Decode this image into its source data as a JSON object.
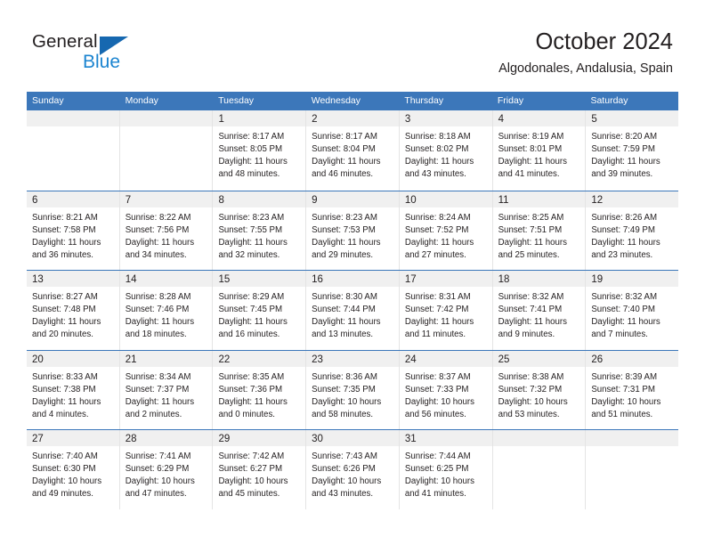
{
  "brand": {
    "name_part1": "General",
    "name_part2": "Blue",
    "triangle_icon": "blue-triangle-icon",
    "blue": "#1668b0",
    "light_blue": "#1b84d0"
  },
  "header": {
    "title": "October 2024",
    "subtitle": "Algodonales, Andalusia, Spain"
  },
  "colors": {
    "header_blue": "#3c77ba",
    "date_band_gray": "#f0f0f0",
    "column_divider": "#e4e4e4",
    "text": "#231f20"
  },
  "calendar": {
    "weekday_headers": [
      "Sunday",
      "Monday",
      "Tuesday",
      "Wednesday",
      "Thursday",
      "Friday",
      "Saturday"
    ],
    "weeks": [
      [
        {
          "date": "",
          "lines": []
        },
        {
          "date": "",
          "lines": []
        },
        {
          "date": "1",
          "lines": [
            "Sunrise: 8:17 AM",
            "Sunset: 8:05 PM",
            "Daylight: 11 hours",
            "and 48 minutes."
          ]
        },
        {
          "date": "2",
          "lines": [
            "Sunrise: 8:17 AM",
            "Sunset: 8:04 PM",
            "Daylight: 11 hours",
            "and 46 minutes."
          ]
        },
        {
          "date": "3",
          "lines": [
            "Sunrise: 8:18 AM",
            "Sunset: 8:02 PM",
            "Daylight: 11 hours",
            "and 43 minutes."
          ]
        },
        {
          "date": "4",
          "lines": [
            "Sunrise: 8:19 AM",
            "Sunset: 8:01 PM",
            "Daylight: 11 hours",
            "and 41 minutes."
          ]
        },
        {
          "date": "5",
          "lines": [
            "Sunrise: 8:20 AM",
            "Sunset: 7:59 PM",
            "Daylight: 11 hours",
            "and 39 minutes."
          ]
        }
      ],
      [
        {
          "date": "6",
          "lines": [
            "Sunrise: 8:21 AM",
            "Sunset: 7:58 PM",
            "Daylight: 11 hours",
            "and 36 minutes."
          ]
        },
        {
          "date": "7",
          "lines": [
            "Sunrise: 8:22 AM",
            "Sunset: 7:56 PM",
            "Daylight: 11 hours",
            "and 34 minutes."
          ]
        },
        {
          "date": "8",
          "lines": [
            "Sunrise: 8:23 AM",
            "Sunset: 7:55 PM",
            "Daylight: 11 hours",
            "and 32 minutes."
          ]
        },
        {
          "date": "9",
          "lines": [
            "Sunrise: 8:23 AM",
            "Sunset: 7:53 PM",
            "Daylight: 11 hours",
            "and 29 minutes."
          ]
        },
        {
          "date": "10",
          "lines": [
            "Sunrise: 8:24 AM",
            "Sunset: 7:52 PM",
            "Daylight: 11 hours",
            "and 27 minutes."
          ]
        },
        {
          "date": "11",
          "lines": [
            "Sunrise: 8:25 AM",
            "Sunset: 7:51 PM",
            "Daylight: 11 hours",
            "and 25 minutes."
          ]
        },
        {
          "date": "12",
          "lines": [
            "Sunrise: 8:26 AM",
            "Sunset: 7:49 PM",
            "Daylight: 11 hours",
            "and 23 minutes."
          ]
        }
      ],
      [
        {
          "date": "13",
          "lines": [
            "Sunrise: 8:27 AM",
            "Sunset: 7:48 PM",
            "Daylight: 11 hours",
            "and 20 minutes."
          ]
        },
        {
          "date": "14",
          "lines": [
            "Sunrise: 8:28 AM",
            "Sunset: 7:46 PM",
            "Daylight: 11 hours",
            "and 18 minutes."
          ]
        },
        {
          "date": "15",
          "lines": [
            "Sunrise: 8:29 AM",
            "Sunset: 7:45 PM",
            "Daylight: 11 hours",
            "and 16 minutes."
          ]
        },
        {
          "date": "16",
          "lines": [
            "Sunrise: 8:30 AM",
            "Sunset: 7:44 PM",
            "Daylight: 11 hours",
            "and 13 minutes."
          ]
        },
        {
          "date": "17",
          "lines": [
            "Sunrise: 8:31 AM",
            "Sunset: 7:42 PM",
            "Daylight: 11 hours",
            "and 11 minutes."
          ]
        },
        {
          "date": "18",
          "lines": [
            "Sunrise: 8:32 AM",
            "Sunset: 7:41 PM",
            "Daylight: 11 hours",
            "and 9 minutes."
          ]
        },
        {
          "date": "19",
          "lines": [
            "Sunrise: 8:32 AM",
            "Sunset: 7:40 PM",
            "Daylight: 11 hours",
            "and 7 minutes."
          ]
        }
      ],
      [
        {
          "date": "20",
          "lines": [
            "Sunrise: 8:33 AM",
            "Sunset: 7:38 PM",
            "Daylight: 11 hours",
            "and 4 minutes."
          ]
        },
        {
          "date": "21",
          "lines": [
            "Sunrise: 8:34 AM",
            "Sunset: 7:37 PM",
            "Daylight: 11 hours",
            "and 2 minutes."
          ]
        },
        {
          "date": "22",
          "lines": [
            "Sunrise: 8:35 AM",
            "Sunset: 7:36 PM",
            "Daylight: 11 hours",
            "and 0 minutes."
          ]
        },
        {
          "date": "23",
          "lines": [
            "Sunrise: 8:36 AM",
            "Sunset: 7:35 PM",
            "Daylight: 10 hours",
            "and 58 minutes."
          ]
        },
        {
          "date": "24",
          "lines": [
            "Sunrise: 8:37 AM",
            "Sunset: 7:33 PM",
            "Daylight: 10 hours",
            "and 56 minutes."
          ]
        },
        {
          "date": "25",
          "lines": [
            "Sunrise: 8:38 AM",
            "Sunset: 7:32 PM",
            "Daylight: 10 hours",
            "and 53 minutes."
          ]
        },
        {
          "date": "26",
          "lines": [
            "Sunrise: 8:39 AM",
            "Sunset: 7:31 PM",
            "Daylight: 10 hours",
            "and 51 minutes."
          ]
        }
      ],
      [
        {
          "date": "27",
          "lines": [
            "Sunrise: 7:40 AM",
            "Sunset: 6:30 PM",
            "Daylight: 10 hours",
            "and 49 minutes."
          ]
        },
        {
          "date": "28",
          "lines": [
            "Sunrise: 7:41 AM",
            "Sunset: 6:29 PM",
            "Daylight: 10 hours",
            "and 47 minutes."
          ]
        },
        {
          "date": "29",
          "lines": [
            "Sunrise: 7:42 AM",
            "Sunset: 6:27 PM",
            "Daylight: 10 hours",
            "and 45 minutes."
          ]
        },
        {
          "date": "30",
          "lines": [
            "Sunrise: 7:43 AM",
            "Sunset: 6:26 PM",
            "Daylight: 10 hours",
            "and 43 minutes."
          ]
        },
        {
          "date": "31",
          "lines": [
            "Sunrise: 7:44 AM",
            "Sunset: 6:25 PM",
            "Daylight: 10 hours",
            "and 41 minutes."
          ]
        },
        {
          "date": "",
          "lines": []
        },
        {
          "date": "",
          "lines": []
        }
      ]
    ]
  }
}
